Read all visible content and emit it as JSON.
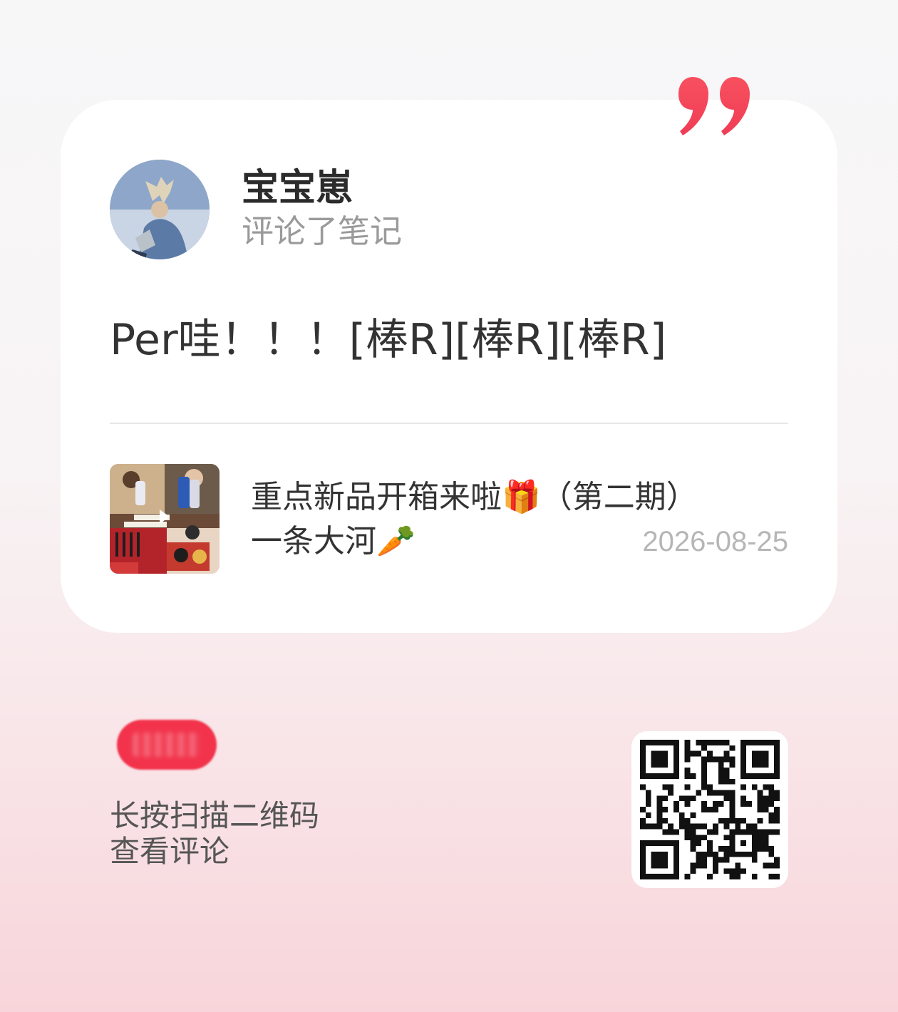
{
  "profile": {
    "username": "宝宝崽",
    "action": "评论了笔记"
  },
  "comment": {
    "text": "Per哇！！！[棒R][棒R][棒R]"
  },
  "note": {
    "title": "重点新品开箱来啦🎁（第二期）",
    "author": "一条大河🥕",
    "date": "2026-08-25"
  },
  "footer": {
    "scan_line1": "长按扫描二维码",
    "scan_line2": "查看评论"
  },
  "colors": {
    "accent": "#f2334b",
    "quote": "#f54a62",
    "background_bottom": "#f8d5da"
  },
  "icons": {
    "quote": "quote-mark-icon",
    "qr": "qr-code-icon"
  }
}
